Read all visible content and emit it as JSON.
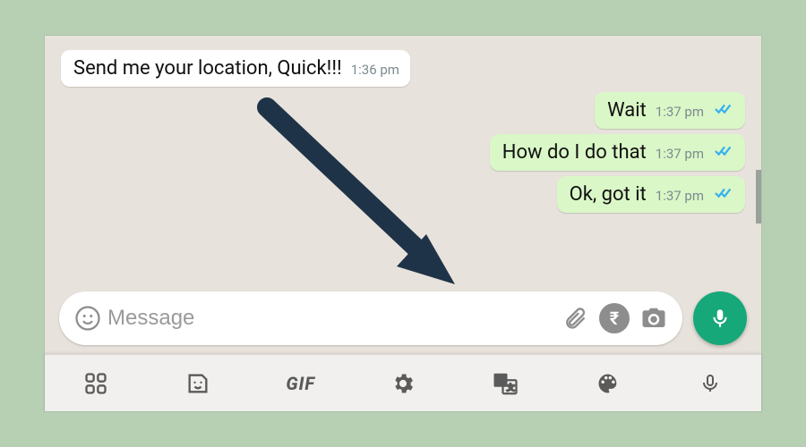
{
  "messages": [
    {
      "dir": "in",
      "text": "Send me your location, Quick!!!",
      "time": "1:36 pm",
      "ticks": false
    },
    {
      "dir": "out",
      "text": "Wait",
      "time": "1:37 pm",
      "ticks": true
    },
    {
      "dir": "out",
      "text": "How do I do that",
      "time": "1:37 pm",
      "ticks": true
    },
    {
      "dir": "out",
      "text": "Ok, got it",
      "time": "1:37 pm",
      "ticks": true
    }
  ],
  "composer": {
    "placeholder": "Message",
    "value": ""
  },
  "keyboard": {
    "gif_label": "GIF"
  },
  "colors": {
    "tick": "#35b0f0",
    "mic_bg": "#17a87a",
    "arrow": "#1f3348"
  }
}
